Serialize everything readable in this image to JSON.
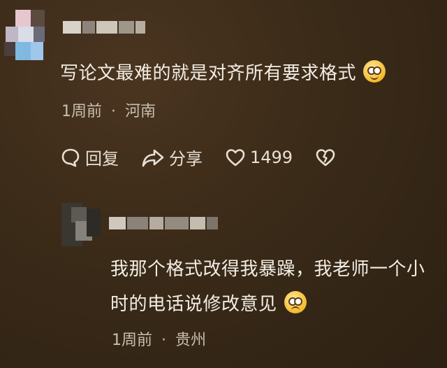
{
  "comment": {
    "text": "写论文最难的就是对齐所有要求格式",
    "time": "1周前",
    "separator": "·",
    "location": "河南",
    "emoji": "grinning-face-icon"
  },
  "actions": {
    "reply_label": "回复",
    "share_label": "分享",
    "like_count": "1499"
  },
  "reply": {
    "line1": "我那个格式改得我暴躁，我老师一个小",
    "line2": "时的电话说修改意见",
    "time": "1周前",
    "separator": "·",
    "location": "贵州",
    "emoji": "woozy-face-icon"
  }
}
